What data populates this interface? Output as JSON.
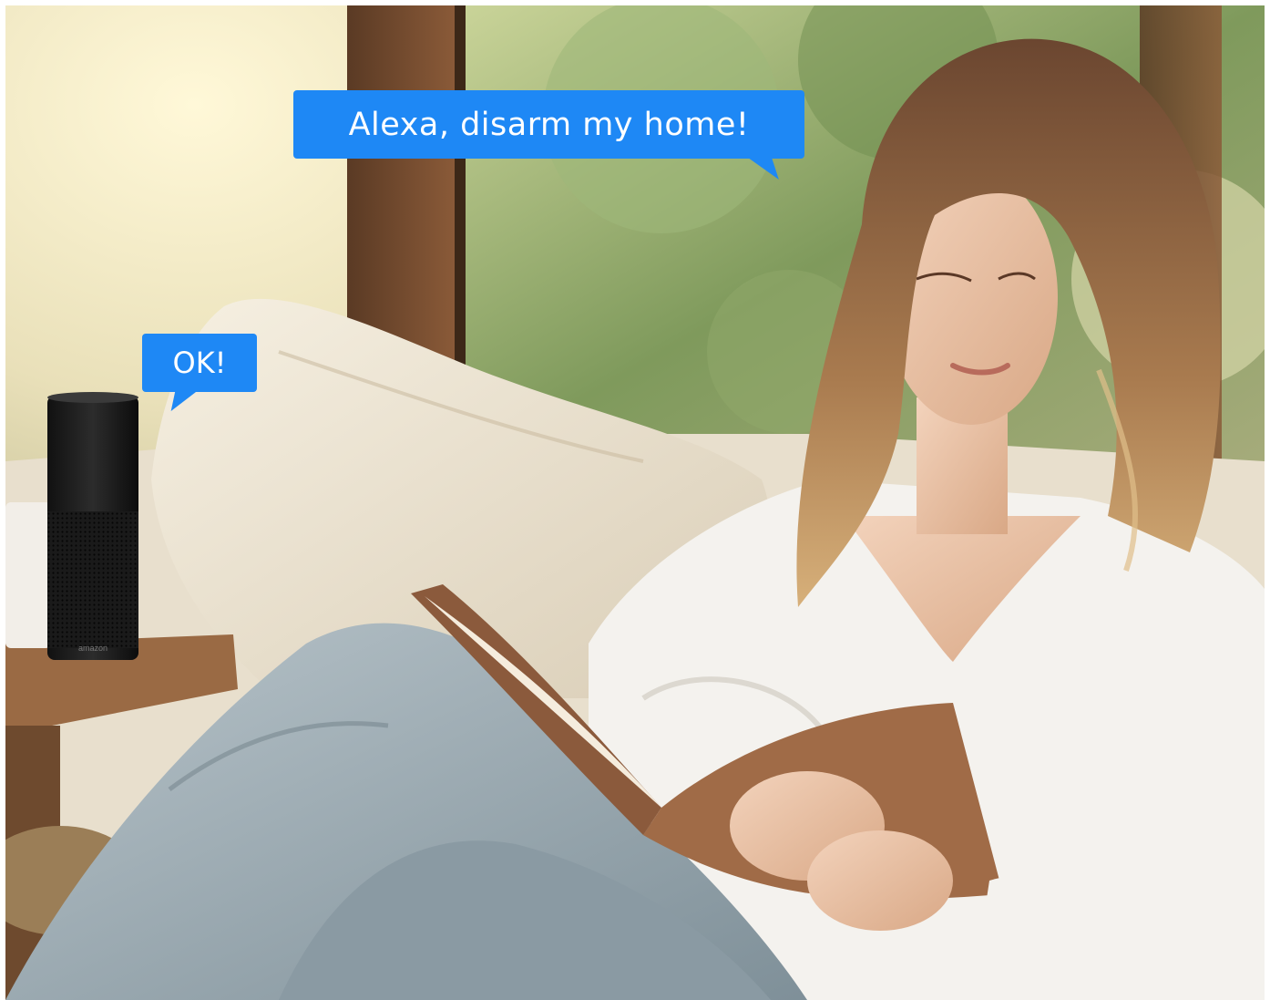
{
  "speech": {
    "user_line": "Alexa, disarm my home!",
    "alexa_reply": "OK!"
  },
  "device": {
    "brand_text": "amazon"
  },
  "colors": {
    "bubble_blue": "#1e88f5",
    "bubble_text": "#ffffff"
  }
}
